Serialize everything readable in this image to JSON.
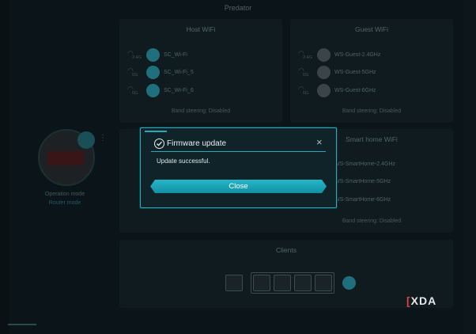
{
  "app_title": "Predator",
  "host_wifi": {
    "title": "Host WiFi",
    "networks": [
      {
        "band": "2.4G",
        "ssid": "SC_Wi-Fi"
      },
      {
        "band": "5G",
        "ssid": "SC_Wi-Fi_5"
      },
      {
        "band": "6G",
        "ssid": "SC_Wi-Fi_6"
      }
    ],
    "band_steering": "Band steering: Disabled"
  },
  "guest_wifi": {
    "title": "Guest WiFi",
    "networks": [
      {
        "band": "2.4G",
        "ssid": "WS-Guest-2.4GHz"
      },
      {
        "band": "5G",
        "ssid": "WS-Guest-5GHz"
      },
      {
        "band": "6G",
        "ssid": "WS-Guest-6GHz"
      }
    ],
    "band_steering": "Band steering: Disabled"
  },
  "smart_home_wifi": {
    "title": "Smart home WiFi",
    "networks": [
      {
        "ssid": "WS-SmartHome-2.4GHz"
      },
      {
        "ssid": "WS-SmartHome-5GHz"
      },
      {
        "ssid": "WS-SmartHome-6GHz"
      }
    ],
    "band_steering": "Band steering: Disabled"
  },
  "router": {
    "operation_mode_label": "Operation mode",
    "operation_mode_value": "Router mode"
  },
  "clients": {
    "title": "Clients"
  },
  "dialog": {
    "title": "Firmware update",
    "message": "Update successful.",
    "close_label": "Close",
    "close_icon": "×"
  },
  "watermark": {
    "bracket": "[",
    "text": "XDA"
  },
  "colors": {
    "accent": "#27a9bb",
    "button": "#1aa3b8",
    "background": "#0b1519"
  }
}
